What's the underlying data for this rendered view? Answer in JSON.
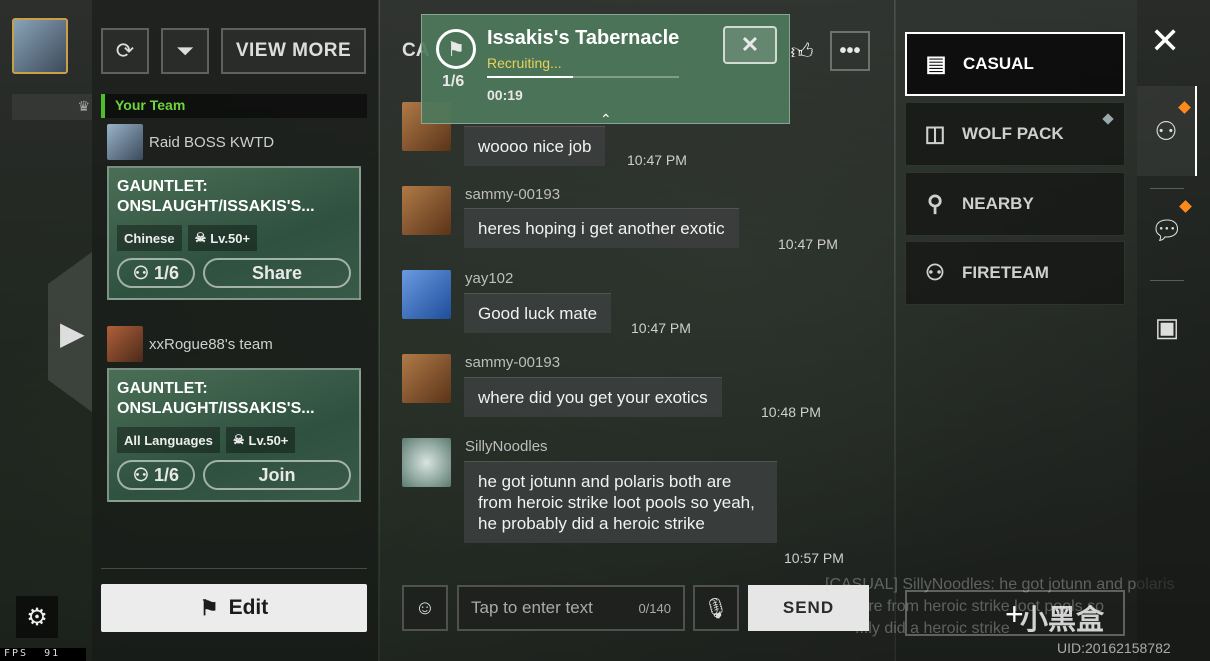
{
  "left": {
    "fps_label": "FPS",
    "fps_value": "91"
  },
  "team_panel": {
    "view_more_label": "VIEW MORE",
    "your_team_label": "Your Team",
    "teams": [
      {
        "leader": "Raid BOSS KWTD",
        "title_line1": "GAUNTLET:",
        "title_line2": "ONSLAUGHT/ISSAKIS'S...",
        "language": "Chinese",
        "level": "Lv.50+",
        "count": "1/6",
        "action": "Share"
      },
      {
        "leader": "xxRogue88's team",
        "title_line1": "GAUNTLET:",
        "title_line2": "ONSLAUGHT/ISSAKIS'S...",
        "language": "All Languages",
        "level": "Lv.50+",
        "count": "1/6",
        "action": "Join"
      }
    ],
    "edit_label": "Edit"
  },
  "chat": {
    "title": "CA",
    "messages": [
      {
        "name": "",
        "text": "woooo nice job",
        "time": "10:47 PM"
      },
      {
        "name": "sammy-00193",
        "text": "heres hoping i get another exotic",
        "time": "10:47 PM"
      },
      {
        "name": "yay102",
        "text": "Good luck mate",
        "time": "10:47 PM"
      },
      {
        "name": "sammy-00193",
        "text": "where did you get your exotics",
        "time": "10:48 PM"
      },
      {
        "name": "SillyNoodles",
        "text": "he got jotunn and polaris both are from heroic strike loot pools so yeah, he probably did a heroic strike",
        "time": "10:57 PM"
      }
    ],
    "input_placeholder": "Tap to enter text",
    "input_count": "0/140",
    "send_label": "SEND"
  },
  "popup": {
    "title": "Issakis's Tabernacle",
    "status": "Recruiting...",
    "count": "1/6",
    "timer": "00:19",
    "progress": 0.45
  },
  "channels": [
    {
      "label": "CASUAL",
      "icon": "chat-icon",
      "active": true
    },
    {
      "label": "WOLF PACK",
      "icon": "banner-icon",
      "active": false
    },
    {
      "label": "NEARBY",
      "icon": "pin-icon",
      "active": false
    },
    {
      "label": "FIRETEAM",
      "icon": "group-icon",
      "active": false
    }
  ],
  "background_text": {
    "line1": "[CASUAL] SillyNoodles: he got jotunn and polaris",
    "line2": "...re from heroic strike loot pools so",
    "line3": "...ly did a heroic strike"
  },
  "footer": {
    "uid": "UID:20162158782",
    "watermark": "小黑盒"
  },
  "colors": {
    "accent_green": "#4cbf2a",
    "popup_green": "#4e785c",
    "notif_orange": "#ff8a1c",
    "recruit_yellow": "#e6d35a"
  }
}
